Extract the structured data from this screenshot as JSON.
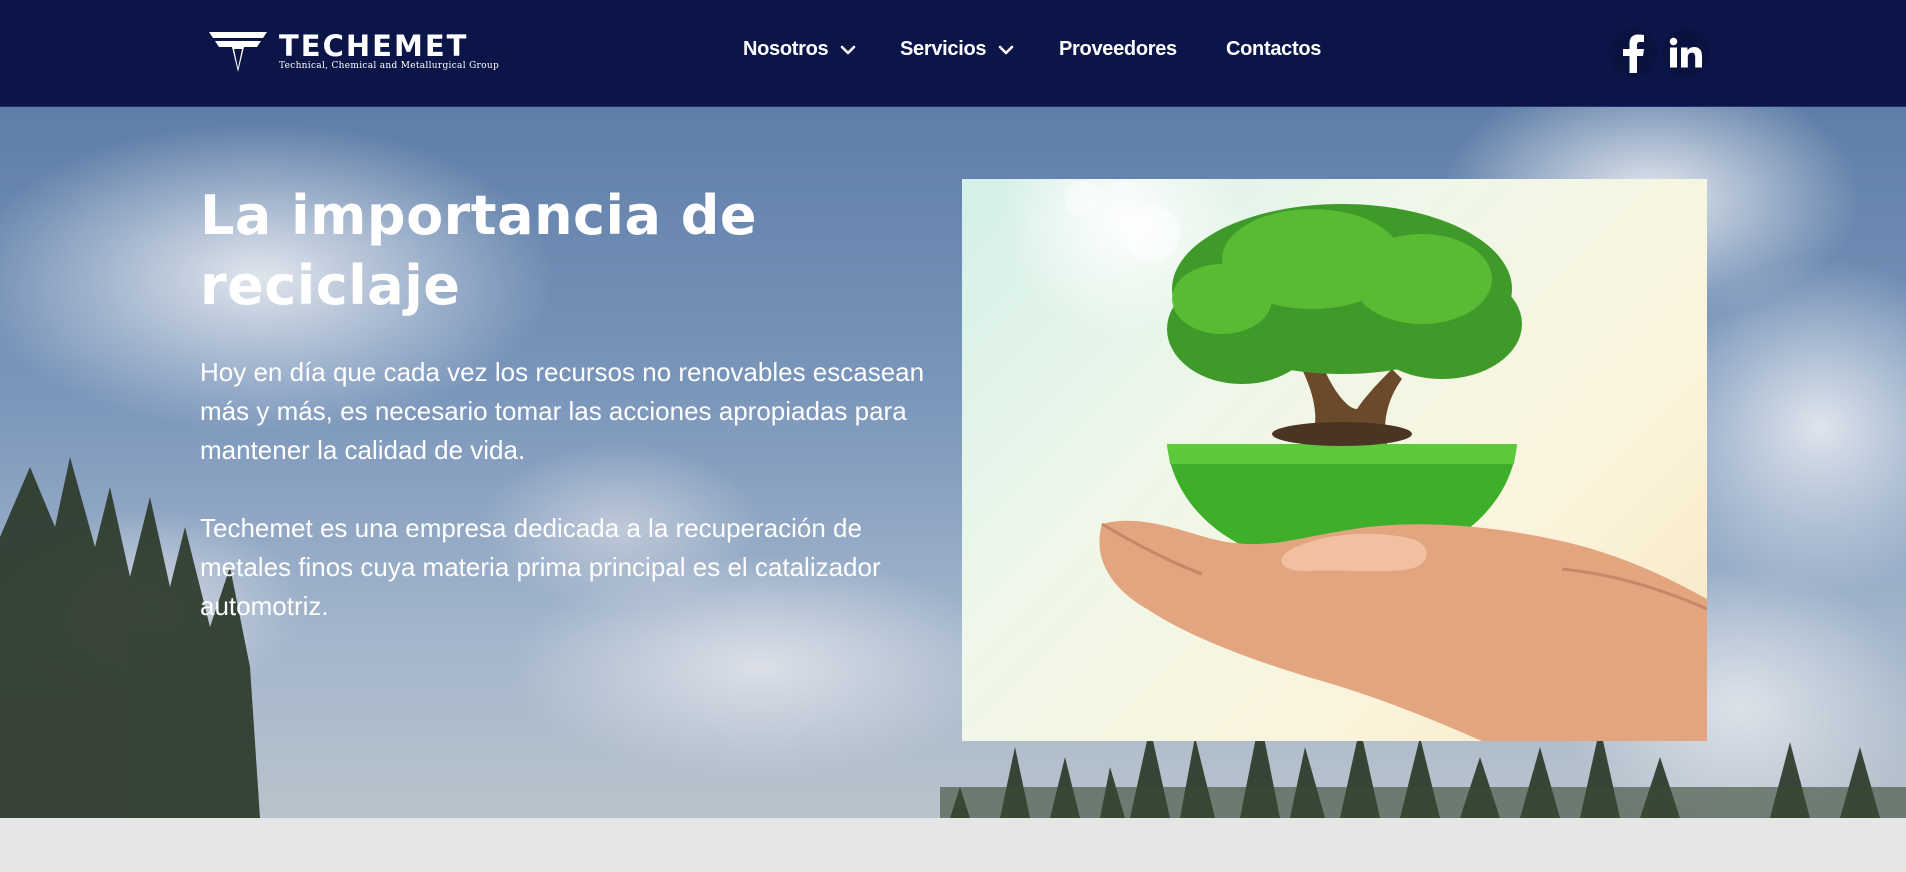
{
  "brand": {
    "name": "TECHEMET",
    "tagline": "Technical, Chemical and Metallurgical Group"
  },
  "nav": {
    "items": [
      {
        "label": "Nosotros",
        "has_dropdown": true
      },
      {
        "label": "Servicios",
        "has_dropdown": true
      },
      {
        "label": "Proveedores",
        "has_dropdown": false
      },
      {
        "label": "Contactos",
        "has_dropdown": false
      }
    ]
  },
  "social": {
    "facebook_icon": "facebook-icon",
    "linkedin_icon": "linkedin-icon"
  },
  "hero": {
    "title": "La importancia de reciclaje",
    "paragraph1": "Hoy en día que cada vez los recursos no renovables escasean más y más, es necesario tomar las acciones apropiadas para mantener la calidad de vida.",
    "paragraph2": "Techemet es una empresa dedicada a la recuperación de metales finos cuya materia prima principal es el catalizador automotriz."
  },
  "colors": {
    "navbar_bg": "#0b1547",
    "text": "#ffffff",
    "page_bg": "#e6e6e6"
  }
}
